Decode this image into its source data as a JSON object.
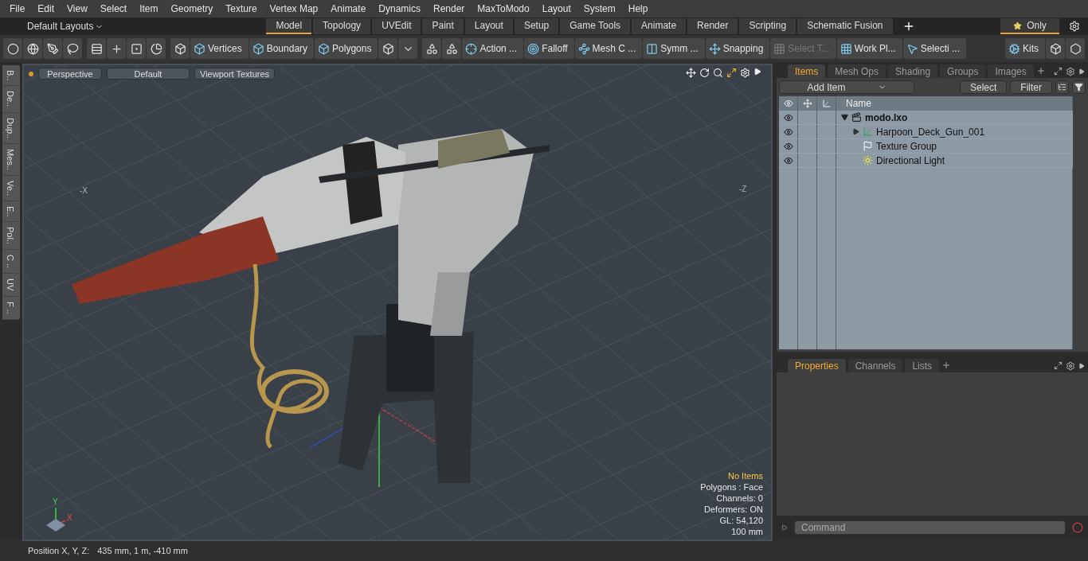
{
  "menu": [
    "File",
    "Edit",
    "View",
    "Select",
    "Item",
    "Geometry",
    "Texture",
    "Vertex Map",
    "Animate",
    "Dynamics",
    "Render",
    "MaxToModo",
    "Layout",
    "System",
    "Help"
  ],
  "layout_bar": {
    "layouts": "Default Layouts",
    "tabs": [
      {
        "label": "Model",
        "selected": true
      },
      {
        "label": "Topology",
        "selected": false
      },
      {
        "label": "UVEdit",
        "selected": false
      },
      {
        "label": "Paint",
        "selected": false
      },
      {
        "label": "Layout",
        "selected": false
      },
      {
        "label": "Setup",
        "selected": false
      },
      {
        "label": "Game Tools",
        "selected": false
      },
      {
        "label": "Animate",
        "selected": false
      },
      {
        "label": "Render",
        "selected": false
      },
      {
        "label": "Scripting",
        "selected": false
      },
      {
        "label": "Schematic Fusion",
        "selected": false
      }
    ],
    "only": "Only"
  },
  "toolbar": {
    "left": [
      {
        "kind": "icon"
      },
      {
        "kind": "icon"
      },
      {
        "kind": "icon"
      },
      {
        "kind": "icon"
      },
      {
        "kind": "gap"
      },
      {
        "kind": "icon"
      },
      {
        "kind": "icon"
      },
      {
        "kind": "icon"
      },
      {
        "kind": "icon"
      },
      {
        "kind": "gap"
      },
      {
        "kind": "icon"
      },
      {
        "kind": "text",
        "label": "Vertices",
        "disabled": false
      },
      {
        "kind": "text",
        "label": "Boundary",
        "disabled": false
      },
      {
        "kind": "text",
        "label": "Polygons",
        "disabled": false
      },
      {
        "kind": "icon"
      },
      {
        "kind": "icon"
      },
      {
        "kind": "gap"
      },
      {
        "kind": "icon"
      },
      {
        "kind": "icon"
      },
      {
        "kind": "text",
        "label": "Action ...",
        "disabled": false
      },
      {
        "kind": "text",
        "label": "Falloff",
        "disabled": false
      },
      {
        "kind": "text",
        "label": "Mesh C ...",
        "disabled": false
      },
      {
        "kind": "text",
        "label": "Symm ...",
        "disabled": false
      },
      {
        "kind": "text",
        "label": "Snapping",
        "disabled": false
      },
      {
        "kind": "text",
        "label": "Select T...",
        "disabled": true
      },
      {
        "kind": "text",
        "label": "Work Pl...",
        "disabled": false
      },
      {
        "kind": "text",
        "label": "Selecti ...",
        "disabled": false
      }
    ],
    "right": [
      {
        "kind": "text",
        "label": "Kits",
        "disabled": false
      },
      {
        "kind": "icon"
      },
      {
        "kind": "icon"
      }
    ]
  },
  "side_tabs": [
    "B..",
    "De..",
    "Dup..",
    "Mes..",
    "Ve..",
    "E..",
    "Pol..",
    "C ..",
    "UV",
    "F .."
  ],
  "viewport": {
    "buttons": [
      "Perspective",
      "Default",
      "Viewport Textures"
    ],
    "axis_labels": [
      "-X",
      "-Z"
    ],
    "gizmo_labels": [
      "Y",
      "X"
    ],
    "info": [
      {
        "text": "No Items",
        "kind": "highlight"
      },
      {
        "text": "Polygons : Face",
        "kind": "plain"
      },
      {
        "text": "Channels: 0",
        "kind": "plain"
      },
      {
        "text": "Deformers: ON",
        "kind": "plain"
      },
      {
        "text": "GL: 54,120",
        "kind": "plain"
      },
      {
        "text": "100 mm",
        "kind": "plain"
      }
    ]
  },
  "items_panel": {
    "tabs": [
      {
        "label": "Items",
        "selected": true
      },
      {
        "label": "Mesh Ops",
        "selected": false
      },
      {
        "label": "Shading",
        "selected": false
      },
      {
        "label": "Groups",
        "selected": false
      },
      {
        "label": "Images",
        "selected": false
      }
    ],
    "add_item": "Add Item",
    "select": "Select",
    "filter": "Filter",
    "name_column": "Name",
    "tree": [
      {
        "name": "modo.lxo",
        "kind": "scene",
        "visible": true,
        "expanded": true,
        "children": [
          {
            "name": "Harpoon_Deck_Gun_001",
            "kind": "mesh",
            "visible": true,
            "expanded": false
          },
          {
            "name": "Texture Group",
            "kind": "texture",
            "visible": true
          },
          {
            "name": "Directional Light",
            "kind": "light",
            "visible": true
          }
        ]
      }
    ]
  },
  "properties_panel": {
    "tabs": [
      {
        "label": "Properties",
        "selected": true
      },
      {
        "label": "Channels",
        "selected": false
      },
      {
        "label": "Lists",
        "selected": false
      }
    ]
  },
  "command": {
    "placeholder": "Command"
  },
  "status": {
    "label": "Position X, Y, Z:",
    "value": "435 mm, 1 m, -410 mm"
  }
}
